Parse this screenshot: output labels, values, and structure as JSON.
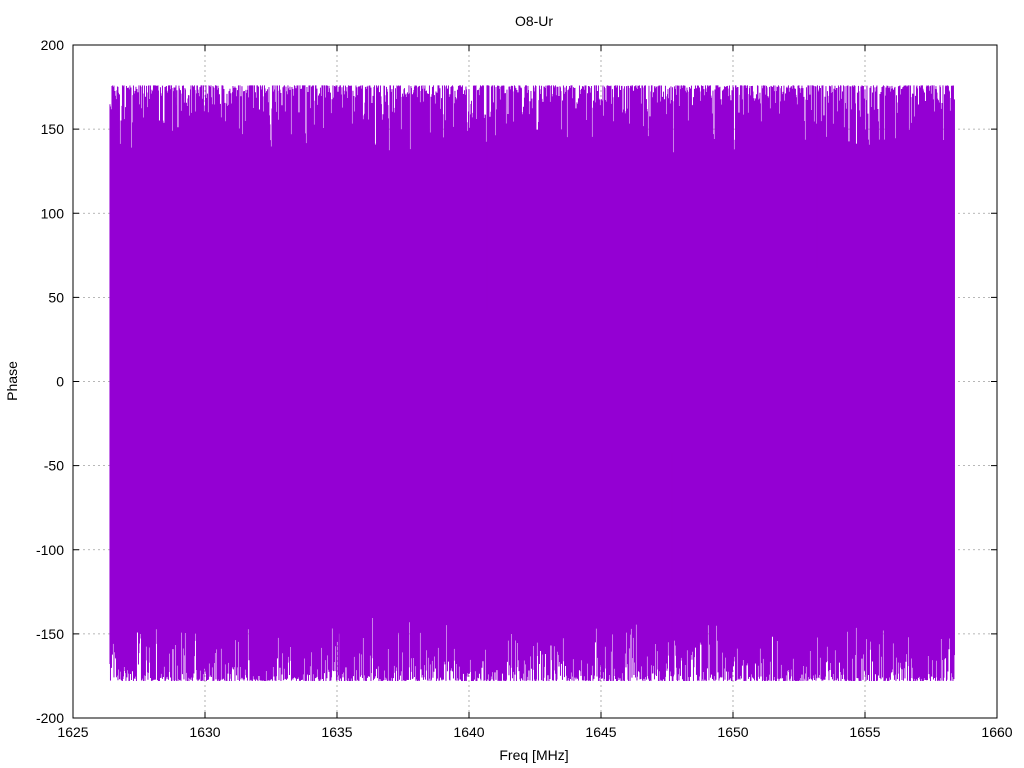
{
  "chart_data": {
    "type": "line",
    "title": "O8-Ur",
    "xlabel": "Freq [MHz]",
    "ylabel": "Phase",
    "xlim": [
      1625,
      1660
    ],
    "ylim": [
      -200,
      200
    ],
    "x_ticks": [
      1625,
      1630,
      1635,
      1640,
      1645,
      1650,
      1655,
      1660
    ],
    "y_ticks": [
      -200,
      -150,
      -100,
      -50,
      0,
      50,
      100,
      150,
      200
    ],
    "grid": true,
    "series": [
      {
        "color": "#9400d3",
        "x_range": [
          1626.4,
          1658.4
        ],
        "envelope_upper": 176,
        "envelope_lower": -178
      }
    ]
  }
}
